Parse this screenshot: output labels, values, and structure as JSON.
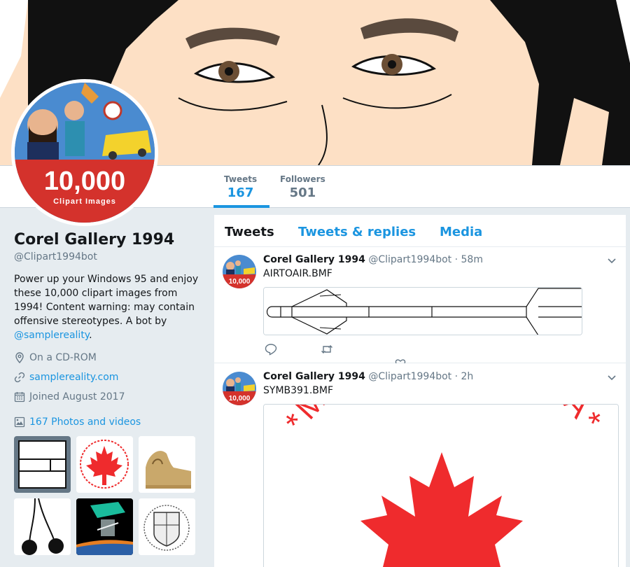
{
  "profile": {
    "name": "Corel Gallery 1994",
    "handle": "@Clipart1994bot",
    "bio_text": "Power up your Windows 95 and enjoy these 10,000 clipart images from 1994! Content warning: may contain offensive stereotypes. A bot by ",
    "bio_link": "@samplereality",
    "bio_end": ".",
    "location": "On a CD-ROM",
    "website": "samplereality.com",
    "joined": "Joined August 2017",
    "photos_label": "167 Photos and videos"
  },
  "avatar": {
    "number": "10,000",
    "caption": "Clipart Images"
  },
  "stats": {
    "tweets_label": "Tweets",
    "tweets_value": "167",
    "followers_label": "Followers",
    "followers_value": "501"
  },
  "tabs": [
    "Tweets",
    "Tweets & replies",
    "Media"
  ],
  "tweets": [
    {
      "name": "Corel Gallery 1994",
      "handle": "@Clipart1994bot",
      "time": "· 58m",
      "text": "AIRTOAIR.BMF"
    },
    {
      "name": "Corel Gallery 1994",
      "handle": "@Clipart1994bot",
      "time": "· 2h",
      "text": "SYMB391.BMF",
      "image_text": "*MADE IN CANADA*"
    }
  ],
  "colors": {
    "accent": "#1b95e0",
    "banner_skin": "#fde0c5",
    "canada_red": "#ef2b2d"
  }
}
